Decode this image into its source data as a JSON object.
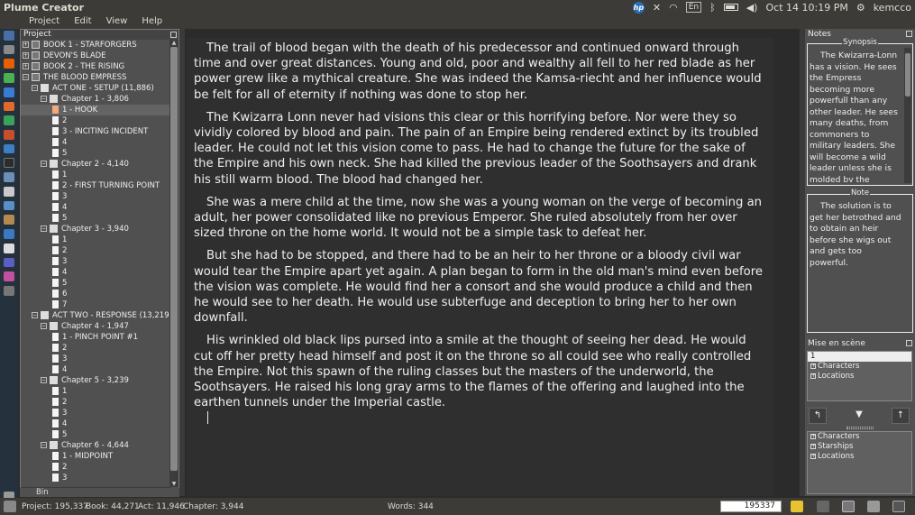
{
  "top_panel": {
    "app_title": "Plume Creator",
    "keyboard": "En",
    "datetime": "Oct 14 10:19 PM",
    "user": "kemcco"
  },
  "menubar": {
    "items": [
      "Project",
      "Edit",
      "View",
      "Help"
    ]
  },
  "project_panel": {
    "title": "Project",
    "tree": [
      {
        "label": "BOOK 1 - STARFORGERS",
        "level": 0,
        "kind": "book"
      },
      {
        "label": "DEVON'S BLADE",
        "level": 0,
        "kind": "book"
      },
      {
        "label": "BOOK 2 - THE RISING",
        "level": 0,
        "kind": "book"
      },
      {
        "label": "THE BLOOD EMPRESS",
        "level": 0,
        "kind": "book-open"
      },
      {
        "label": "ACT ONE - SETUP (11,886)",
        "level": 1,
        "kind": "act"
      },
      {
        "label": "Chapter 1 - 3,806",
        "level": 2,
        "kind": "chapter"
      },
      {
        "label": "1 - HOOK",
        "level": 3,
        "kind": "scene",
        "selected": true
      },
      {
        "label": "2",
        "level": 3,
        "kind": "scene"
      },
      {
        "label": "3 - INCITING INCIDENT",
        "level": 3,
        "kind": "scene"
      },
      {
        "label": "4",
        "level": 3,
        "kind": "scene"
      },
      {
        "label": "5",
        "level": 3,
        "kind": "scene"
      },
      {
        "label": "Chapter 2 - 4,140",
        "level": 2,
        "kind": "chapter"
      },
      {
        "label": "1",
        "level": 3,
        "kind": "scene"
      },
      {
        "label": "2 - FIRST TURNING POINT",
        "level": 3,
        "kind": "scene"
      },
      {
        "label": "3",
        "level": 3,
        "kind": "scene"
      },
      {
        "label": "4",
        "level": 3,
        "kind": "scene"
      },
      {
        "label": "5",
        "level": 3,
        "kind": "scene"
      },
      {
        "label": "Chapter 3 - 3,940",
        "level": 2,
        "kind": "chapter"
      },
      {
        "label": "1",
        "level": 3,
        "kind": "scene"
      },
      {
        "label": "2",
        "level": 3,
        "kind": "scene"
      },
      {
        "label": "3",
        "level": 3,
        "kind": "scene"
      },
      {
        "label": "4",
        "level": 3,
        "kind": "scene"
      },
      {
        "label": "5",
        "level": 3,
        "kind": "scene"
      },
      {
        "label": "6",
        "level": 3,
        "kind": "scene"
      },
      {
        "label": "7",
        "level": 3,
        "kind": "scene"
      },
      {
        "label": "ACT TWO - RESPONSE (13,219)",
        "level": 1,
        "kind": "act"
      },
      {
        "label": "Chapter 4 - 1,947",
        "level": 2,
        "kind": "chapter"
      },
      {
        "label": "1 - PINCH POINT #1",
        "level": 3,
        "kind": "scene"
      },
      {
        "label": "2",
        "level": 3,
        "kind": "scene"
      },
      {
        "label": "3",
        "level": 3,
        "kind": "scene"
      },
      {
        "label": "4",
        "level": 3,
        "kind": "scene"
      },
      {
        "label": "Chapter 5 - 3,239",
        "level": 2,
        "kind": "chapter"
      },
      {
        "label": "1",
        "level": 3,
        "kind": "scene"
      },
      {
        "label": "2",
        "level": 3,
        "kind": "scene"
      },
      {
        "label": "3",
        "level": 3,
        "kind": "scene"
      },
      {
        "label": "4",
        "level": 3,
        "kind": "scene"
      },
      {
        "label": "5",
        "level": 3,
        "kind": "scene"
      },
      {
        "label": "Chapter 6 - 4,644",
        "level": 2,
        "kind": "chapter"
      },
      {
        "label": "1 - MIDPOINT",
        "level": 3,
        "kind": "scene"
      },
      {
        "label": "2",
        "level": 3,
        "kind": "scene"
      },
      {
        "label": "3",
        "level": 3,
        "kind": "scene"
      }
    ],
    "trash_label": "Bin"
  },
  "editor": {
    "paragraphs": [
      "The trail of blood began with the death of his predecessor and continued onward through time and over great distances. Young and old, poor and wealthy all fell to her red blade as her power grew like a mythical creature. She was indeed the Kamsa-riecht and her influence would be felt for all of eternity if nothing was done to stop her.",
      " The Kwizarra Lonn never had visions this clear or this horrifying before. Nor were they so vividly colored by blood and pain. The pain of an Empire being rendered extinct by its troubled leader. He could not let this vision come to pass. He had to change the future for the sake of the Empire and his own neck. She had killed the previous leader of the Soothsayers and drank his still warm blood. The blood had changed her.",
      "She was a mere child at the time, now she was a young woman on the verge of becoming an adult, her power consolidated like no previous Emperor. She ruled absolutely from her over sized throne on the home world. It would not be a simple task to defeat her.",
      "But she had to be stopped, and there had to be an heir to her throne or a bloody civil war would tear the Empire apart yet again. A plan began to form in the old man's mind even before the vision was complete. He would find her a consort and she would produce a child and then he would see to her death. He would use subterfuge and deception to bring her to her own downfall.",
      "His wrinkled old black lips pursed into a smile at the thought of seeing her dead. He would cut off her pretty head himself and post it on the throne so all could see who really controlled the Empire. Not this spawn of the ruling classes but the masters of the underworld, the Soothsayers. He raised his long gray arms to the flames of the offering and laughed into the earthen tunnels under the Imperial castle."
    ]
  },
  "notes_panel": {
    "title": "Notes",
    "synopsis_legend": "Synopsis",
    "synopsis_text": "The Kwizarra-Lonn has a vision. He sees the Empress becoming more powerfull than any other leader. He sees many deaths, from commoners to military leaders. She will become a wild leader unless she is molded by the",
    "note_legend": "Note",
    "note_text": "The solution is to get her betrothed and to obtain an heir before she wigs out and gets too  powerful."
  },
  "mise_panel": {
    "title": "Mise en scène",
    "list1": [
      "1",
      "Characters",
      "Locations"
    ],
    "list2": [
      "Characters",
      "Starships",
      "Locations"
    ]
  },
  "statusbar": {
    "project": "Project: 195,337",
    "book": "Book: 44,271",
    "act": "Act: 11,946",
    "chapter": "Chapter: 3,944",
    "words": "Words: 344",
    "goto_value": "195337"
  },
  "colors": {
    "editor_bg": "#2f2f2f",
    "panel_bg": "#505050",
    "selected_scene": "#f4a97c"
  }
}
